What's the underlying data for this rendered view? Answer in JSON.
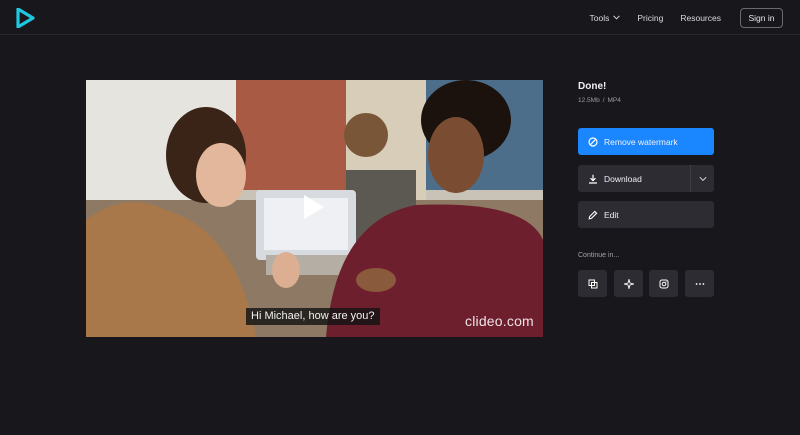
{
  "header": {
    "nav": {
      "tools_label": "Tools",
      "pricing_label": "Pricing",
      "resources_label": "Resources",
      "signin_label": "Sign in"
    }
  },
  "video": {
    "caption": "Hi Michael, how are you?",
    "watermark": "clideo.com"
  },
  "result": {
    "title": "Done!",
    "file_size": "12.5Mb",
    "separator": "/",
    "file_format": "MP4"
  },
  "actions": {
    "remove_watermark_label": "Remove watermark",
    "download_label": "Download",
    "edit_label": "Edit"
  },
  "continue": {
    "label": "Continue in..."
  },
  "colors": {
    "background": "#18181c",
    "accent": "#1a86ff",
    "logo": "#1fc7e0",
    "button_dark": "#2c2c32"
  },
  "icons": {
    "logo": "play-triangle-logo",
    "remove_watermark": "no-sign-icon",
    "download": "download-icon",
    "edit": "pencil-icon",
    "tools": [
      "merge-icon",
      "sparkle-icon",
      "instagram-icon",
      "more-icon"
    ]
  }
}
